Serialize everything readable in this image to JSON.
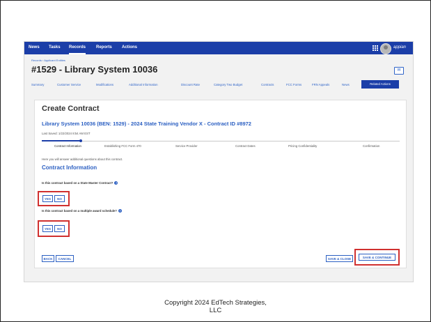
{
  "nav": {
    "items": [
      "News",
      "Tasks",
      "Records",
      "Reports",
      "Actions"
    ],
    "active": "Records",
    "brand": "appian"
  },
  "breadcrumb": "Records  ›  Applicant Entities",
  "record_title": "#1529 - Library System 10036",
  "tabs": [
    "Summary",
    "Customer Service",
    "Modifications",
    "Additional Information",
    "Discount Rate",
    "Category Two Budget",
    "Contracts",
    "FCC Forms",
    "FRN Appeals",
    "News"
  ],
  "active_tab": "Related Actions",
  "card": {
    "title": "Create Contract",
    "subtitle": "Library System 10036 (BEN: 1529) - 2024 State Training Vendor X - Contract ID #8972",
    "last_saved": "Last Saved: 1/22/2024 8:54 AM EST",
    "steps": [
      "Contract Information",
      "Establishing FCC Form 470",
      "Service Provider",
      "Contract Dates",
      "Pricing Confidentiality",
      "Confirmation"
    ],
    "intro": "Here you will answer additional questions about this contract.",
    "section_title": "Contract Information",
    "q1": "Is this contract based on a State Master Contract?",
    "q2": "Is this contract based on a multiple award schedule?",
    "yes_label": "YES",
    "no_label": "NO",
    "back_label": "BACK",
    "cancel_label": "CANCEL",
    "save_close_label": "SAVE & CLOSE",
    "save_continue_label": "SAVE & CONTINUE"
  },
  "icons": {
    "grid": "grid-menu-icon",
    "help": "help-circle-icon",
    "message": "message-icon",
    "avatar": "user-avatar"
  },
  "colors": {
    "nav_blue": "#1b3ea8",
    "link_blue": "#2b5fc2",
    "highlight_red": "#d0302f"
  },
  "footer": {
    "line1": "Copyright 2024 EdTech Strategies,",
    "line2": "LLC"
  }
}
